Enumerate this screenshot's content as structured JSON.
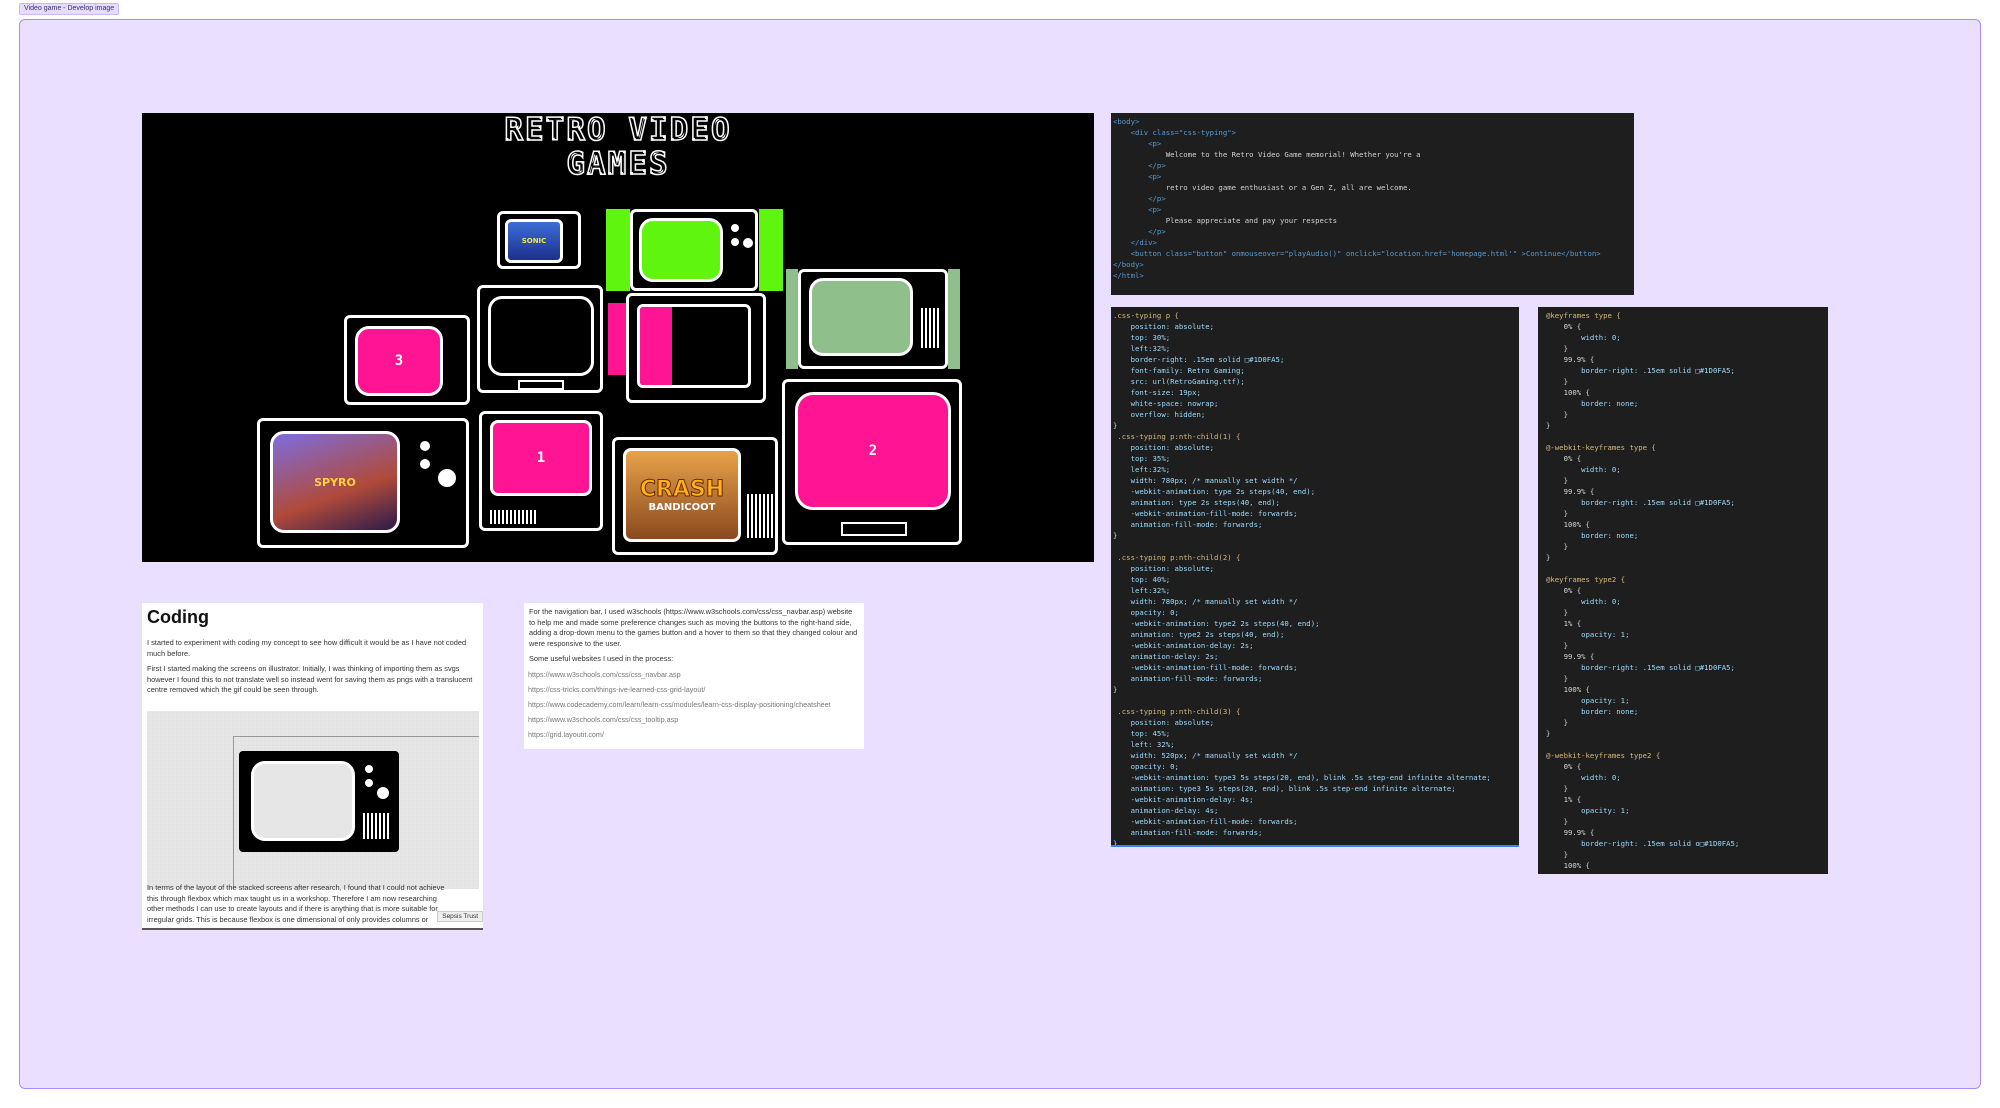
{
  "frame": {
    "label": "Video game - Develop image"
  },
  "hero": {
    "title_line1": "RETRO VIDEO",
    "title_line2": "GAMES",
    "tv_numbers": [
      "3",
      "1",
      "2"
    ],
    "game_art": {
      "sonic": "SONIC",
      "crash_title": "CRASH",
      "crash_sub": "BANDICOOT",
      "spyro": "SPYRO"
    },
    "colors": {
      "pink": "#ff1493",
      "green": "#5ff50f",
      "sage": "#8fbf8a",
      "background": "#000000"
    }
  },
  "html_code": {
    "lines": [
      "<body>",
      "    <div class=\"css-typing\">",
      "        <p>",
      "            Welcome to the Retro Video Game memorial! Whether you're a",
      "        </p>",
      "        <p>",
      "            retro video game enthusiast or a Gen Z, all are welcome.",
      "        </p>",
      "        <p>",
      "            Please appreciate and pay your respects",
      "        </p>",
      "    </div>",
      "    <button class=\"button\" onmouseover=\"playAudio()\" onclick=\"location.href='homepage.html'\" >Continue</button>",
      "</body>",
      "</html>"
    ]
  },
  "css_code": {
    "lines": [
      ".css-typing p {",
      "    position: absolute;",
      "    top: 30%;",
      "    left:32%;",
      "    border-right: .15em solid □#1D0FA5;",
      "    font-family: Retro Gaming;",
      "    src: url(RetroGaming.ttf);",
      "    font-size: 19px;",
      "    white-space: nowrap;",
      "    overflow: hidden;",
      "}",
      " .css-typing p:nth-child(1) {",
      "    position: absolute;",
      "    top: 35%;",
      "    left:32%;",
      "    width: 780px; /* manually set width */",
      "    -webkit-animation: type 2s steps(40, end);",
      "    animation: type 2s steps(40, end);",
      "    -webkit-animation-fill-mode: forwards;",
      "    animation-fill-mode: forwards;",
      "}",
      "",
      " .css-typing p:nth-child(2) {",
      "    position: absolute;",
      "    top: 40%;",
      "    left:32%;",
      "    width: 780px; /* manually set width */",
      "    opacity: 0;",
      "    -webkit-animation: type2 2s steps(40, end);",
      "    animation: type2 2s steps(40, end);",
      "    -webkit-animation-delay: 2s;",
      "    animation-delay: 2s;",
      "    -webkit-animation-fill-mode: forwards;",
      "    animation-fill-mode: forwards;",
      "}",
      "",
      " .css-typing p:nth-child(3) {",
      "    position: absolute;",
      "    top: 45%;",
      "    left: 32%;",
      "    width: 520px; /* manually set width */",
      "    opacity: 0;",
      "    -webkit-animation: type3 5s steps(20, end), blink .5s step-end infinite alternate;",
      "    animation: type3 5s steps(20, end), blink .5s step-end infinite alternate;",
      "    -webkit-animation-delay: 4s;",
      "    animation-delay: 4s;",
      "    -webkit-animation-fill-mode: forwards;",
      "    animation-fill-mode: forwards;",
      "}"
    ]
  },
  "keyframes_code": {
    "lines": [
      "@keyframes type {",
      "    0% {",
      "        width: 0;",
      "    }",
      "    99.9% {",
      "        border-right: .15em solid □#1D0FA5;",
      "    }",
      "    100% {",
      "        border: none;",
      "    }",
      "}",
      "",
      "@-webkit-keyframes type {",
      "    0% {",
      "        width: 0;",
      "    }",
      "    99.9% {",
      "        border-right: .15em solid □#1D0FA5;",
      "    }",
      "    100% {",
      "        border: none;",
      "    }",
      "}",
      "",
      "@keyframes type2 {",
      "    0% {",
      "        width: 0;",
      "    }",
      "    1% {",
      "        opacity: 1;",
      "    }",
      "    99.9% {",
      "        border-right: .15em solid □#1D0FA5;",
      "    }",
      "    100% {",
      "        opacity: 1;",
      "        border: none;",
      "    }",
      "}",
      "",
      "@-webkit-keyframes type2 {",
      "    0% {",
      "        width: 0;",
      "    }",
      "    1% {",
      "        opacity: 1;",
      "    }",
      "    99.9% {",
      "        border-right: .15em solid o□#1D0FA5;",
      "    }",
      "    100% {"
    ]
  },
  "coding_doc": {
    "title": "Coding",
    "para1": "I started to experiment with coding my concept to see how difficult it would be as I have not coded much before.",
    "para2": "First I started making the screens on illustrator. Initially, I was thinking of importing them as svgs however I found this to not translate well so instead went for saving them as pngs with a translucent centre removed which the gif could be seen through.",
    "para3": "In terms of the layout of the stacked screens after research, I found that I could not achieve this through flexbox which max taught us in a workshop. Therefore I am now researching other methods I can use to create layouts and if there is anything that is more suitable for irregular grids. This is because flexbox is one dimensional of only provides columns or rows.",
    "badge": "Sepsis Trust"
  },
  "nav_doc": {
    "para1": "For the navigation bar, I used w3schools (https://www.w3schools.com/css/css_navbar.asp) website to help me and made some preference changes such as moving the buttons to the right-hand side, adding a drop-down menu to the games button and a hover to them so that they changed colour and were responsive to the user.",
    "para2": "Some useful websites I used in the process:",
    "links": [
      "https://www.w3schools.com/css/css_navbar.asp",
      "https://css-tricks.com/things-ive-learned-css-grid-layout/",
      "https://www.codecademy.com/learn/learn-css/modules/learn-css-display-positioning/cheatsheet",
      "https://www.w3schools.com/css/css_tooltip.asp",
      "https://grid.layoutit.com/"
    ]
  }
}
